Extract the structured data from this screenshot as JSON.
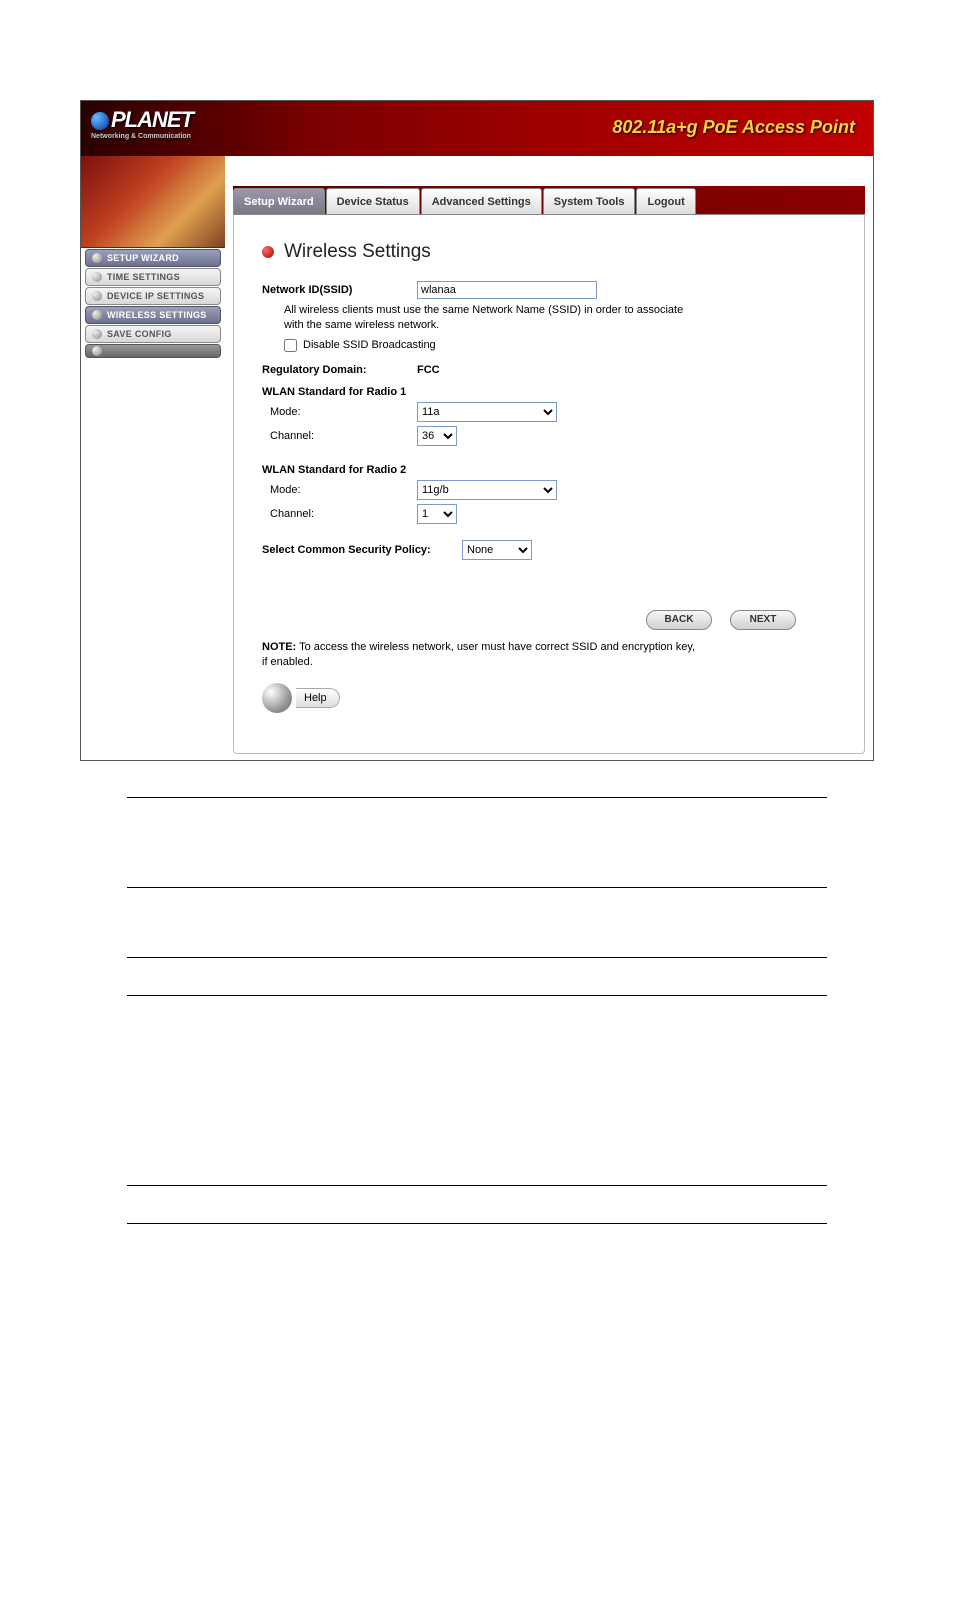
{
  "header": {
    "logo_text": "PLANET",
    "logo_sub": "Networking & Communication",
    "title": "802.11a+g PoE Access Point"
  },
  "sidebar": {
    "items": [
      {
        "label": "Setup Wizard",
        "active": true
      },
      {
        "label": "Time Settings",
        "active": false
      },
      {
        "label": "Device IP Settings",
        "active": false
      },
      {
        "label": "Wireless Settings",
        "active": true
      },
      {
        "label": "Save Config",
        "active": false
      }
    ]
  },
  "tabs": [
    {
      "label": "Setup Wizard",
      "active": true
    },
    {
      "label": "Device Status",
      "active": false
    },
    {
      "label": "Advanced Settings",
      "active": false
    },
    {
      "label": "System Tools",
      "active": false
    },
    {
      "label": "Logout",
      "active": false
    }
  ],
  "panel": {
    "title": "Wireless Settings",
    "ssid_label": "Network ID(SSID)",
    "ssid_value": "wlanaa",
    "ssid_note": "All wireless clients must use the same Network Name (SSID) in order to associate with the same wireless network.",
    "disable_broadcast_label": "Disable SSID Broadcasting",
    "disable_broadcast_checked": false,
    "reg_domain_label": "Regulatory Domain:",
    "reg_domain_value": "FCC",
    "radio1_head": "WLAN Standard for Radio 1",
    "mode_label": "Mode:",
    "channel_label": "Channel:",
    "radio1_mode": "11a",
    "radio1_channel": "36",
    "radio2_head": "WLAN Standard for Radio 2",
    "radio2_mode": "11g/b",
    "radio2_channel": "1",
    "security_label": "Select Common Security Policy:",
    "security_value": "None",
    "back_btn": "BACK",
    "next_btn": "NEXT",
    "note_prefix": "NOTE:",
    "note_text": " To access the wireless network, user must have correct SSID and encryption key, if enabled.",
    "help_label": "Help"
  }
}
